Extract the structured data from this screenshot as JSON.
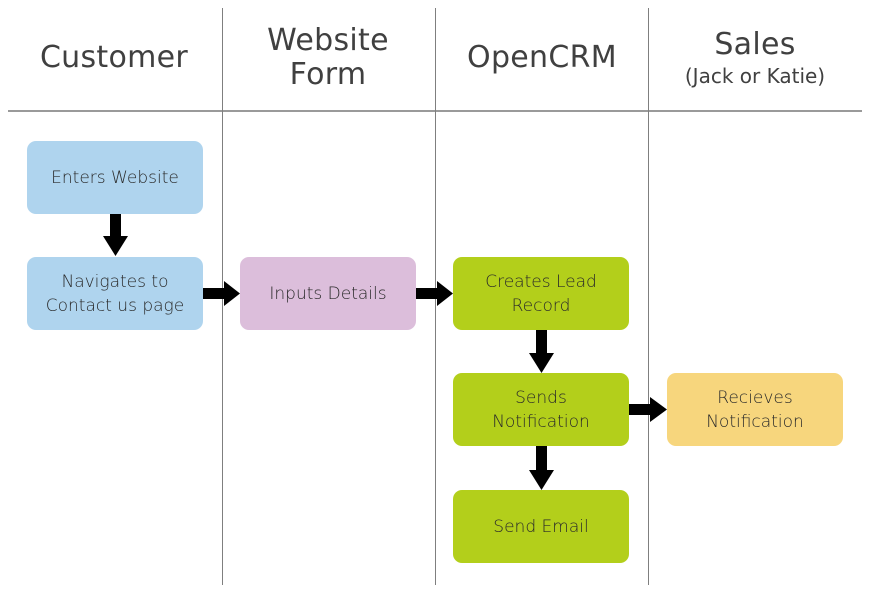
{
  "colors": {
    "customer": "#afd4ee",
    "website_form": "#dcbedb",
    "opencrm": "#b3cf1b",
    "sales": "#f7d67d",
    "arrow": "#000000",
    "divider": "#9a9a9a",
    "header_text": "#404040"
  },
  "lanes": [
    {
      "title": "Customer",
      "subtitle": ""
    },
    {
      "title": "Website\nForm",
      "subtitle": ""
    },
    {
      "title": "OpenCRM",
      "subtitle": ""
    },
    {
      "title": "Sales",
      "subtitle": "(Jack or Katie)"
    }
  ],
  "nodes": [
    {
      "id": "enters-website",
      "lane": 0,
      "label": "Enters Website"
    },
    {
      "id": "navigates-contact",
      "lane": 0,
      "label": "Navigates to\nContact us page"
    },
    {
      "id": "inputs-details",
      "lane": 1,
      "label": "Inputs Details"
    },
    {
      "id": "creates-lead",
      "lane": 2,
      "label": "Creates Lead\nRecord"
    },
    {
      "id": "sends-notification",
      "lane": 2,
      "label": "Sends\nNotification"
    },
    {
      "id": "send-email",
      "lane": 2,
      "label": "Send Email"
    },
    {
      "id": "receives-notification",
      "lane": 3,
      "label": "Recieves\nNotification"
    }
  ],
  "edges": [
    {
      "from": "enters-website",
      "to": "navigates-contact"
    },
    {
      "from": "navigates-contact",
      "to": "inputs-details"
    },
    {
      "from": "inputs-details",
      "to": "creates-lead"
    },
    {
      "from": "creates-lead",
      "to": "sends-notification"
    },
    {
      "from": "sends-notification",
      "to": "receives-notification"
    },
    {
      "from": "sends-notification",
      "to": "send-email"
    }
  ]
}
